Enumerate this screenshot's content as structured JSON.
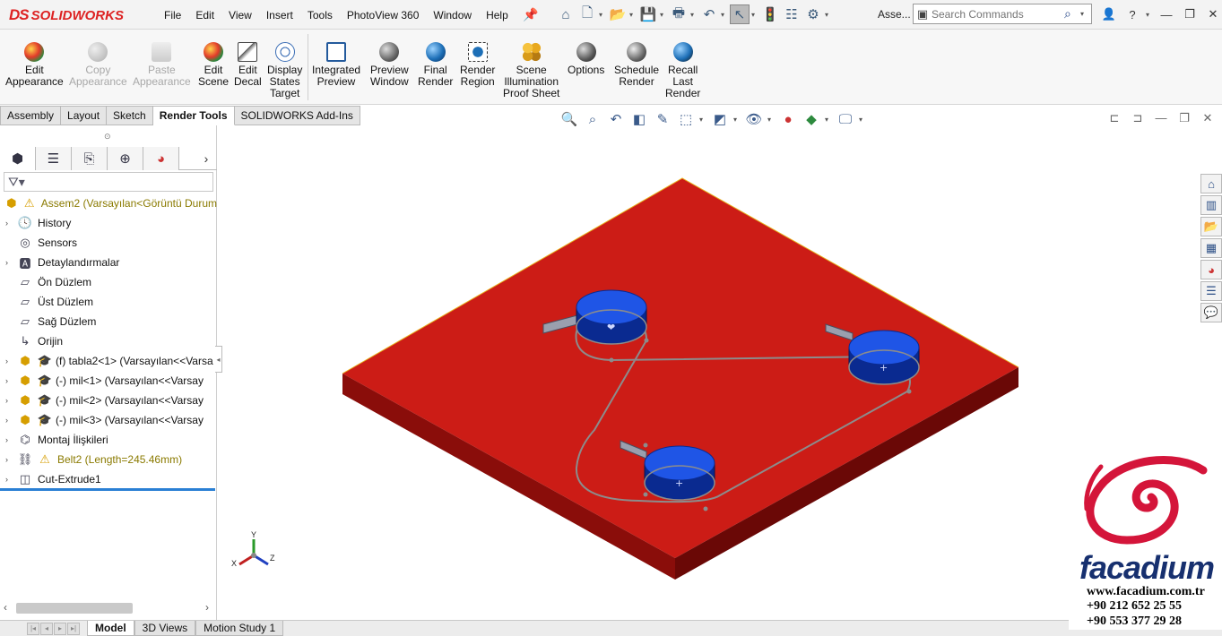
{
  "app": {
    "logo_ds": "DS",
    "logo_text": "SOLIDWORKS",
    "menu": [
      "File",
      "Edit",
      "View",
      "Insert",
      "Tools",
      "PhotoView 360",
      "Window",
      "Help"
    ],
    "doc_title": "Asse...",
    "search": {
      "placeholder": "Search Commands"
    }
  },
  "ribbon": {
    "buttons": [
      {
        "label": "Edit Appearance",
        "enabled": true
      },
      {
        "label": "Copy Appearance",
        "enabled": false
      },
      {
        "label": "Paste Appearance",
        "enabled": false
      },
      {
        "label": "Edit Scene",
        "enabled": true
      },
      {
        "label": "Edit Decal",
        "enabled": true
      },
      {
        "label": "Display States Target",
        "enabled": true
      },
      {
        "label": "Integrated Preview",
        "enabled": true
      },
      {
        "label": "Preview Window",
        "enabled": true
      },
      {
        "label": "Final Render",
        "enabled": true
      },
      {
        "label": "Render Region",
        "enabled": true
      },
      {
        "label": "Scene Illumination Proof Sheet",
        "enabled": true
      },
      {
        "label": "Options",
        "enabled": true
      },
      {
        "label": "Schedule Render",
        "enabled": true
      },
      {
        "label": "Recall Last Render",
        "enabled": true
      }
    ],
    "labels": {
      "edit_appearance": [
        "Edit",
        "Appearance"
      ],
      "copy_appearance": [
        "Copy",
        "Appearance"
      ],
      "paste_appearance": [
        "Paste",
        "Appearance"
      ],
      "edit_scene": [
        "Edit",
        "Scene"
      ],
      "edit_decal": [
        "Edit",
        "Decal"
      ],
      "display_states": [
        "Display",
        "States",
        "Target"
      ],
      "integrated_preview": [
        "Integrated",
        "Preview"
      ],
      "preview_window": [
        "Preview",
        "Window"
      ],
      "final_render": [
        "Final",
        "Render"
      ],
      "render_region": [
        "Render",
        "Region"
      ],
      "scene_illum": [
        "Scene",
        "Illumination",
        "Proof Sheet"
      ],
      "options": [
        "Options"
      ],
      "schedule_render": [
        "Schedule",
        "Render"
      ],
      "recall_render": [
        "Recall",
        "Last",
        "Render"
      ]
    }
  },
  "command_tabs": [
    "Assembly",
    "Layout",
    "Sketch",
    "Render Tools",
    "SOLIDWORKS Add-Ins"
  ],
  "active_command_tab": "Render Tools",
  "feature_tree": {
    "root": "Assem2  (Varsayılan<Görüntü Durum",
    "items": [
      {
        "label": "History",
        "icon": "history-icon",
        "expandable": true
      },
      {
        "label": "Sensors",
        "icon": "sensors-icon",
        "expandable": false
      },
      {
        "label": "Detaylandırmalar",
        "icon": "annotations-icon",
        "expandable": true
      },
      {
        "label": "Ön Düzlem",
        "icon": "plane-icon",
        "expandable": false
      },
      {
        "label": "Üst Düzlem",
        "icon": "plane-icon",
        "expandable": false
      },
      {
        "label": "Sağ Düzlem",
        "icon": "plane-icon",
        "expandable": false
      },
      {
        "label": "Orijin",
        "icon": "origin-icon",
        "expandable": false
      },
      {
        "label": "(f) tabla2<1>  (Varsayılan<<Varsa",
        "icon": "part-icon",
        "expandable": true
      },
      {
        "label": "(-) mil<1>  (Varsayılan<<Varsay",
        "icon": "part-icon",
        "expandable": true
      },
      {
        "label": "(-) mil<2>  (Varsayılan<<Varsay",
        "icon": "part-icon",
        "expandable": true
      },
      {
        "label": "(-) mil<3>  (Varsayılan<<Varsay",
        "icon": "part-icon",
        "expandable": true
      },
      {
        "label": "Montaj İlişkileri",
        "icon": "mates-icon",
        "expandable": true
      },
      {
        "label": "Belt2 (Length=245.46mm)",
        "icon": "belt-icon",
        "expandable": true,
        "warning": true
      },
      {
        "label": "Cut-Extrude1",
        "icon": "cut-extrude-icon",
        "expandable": true
      }
    ]
  },
  "bottom_tabs": [
    "Model",
    "3D Views",
    "Motion Study 1"
  ],
  "active_bottom_tab": "Model",
  "triad": {
    "x": "X",
    "y": "Y",
    "z": "Z"
  },
  "watermark": {
    "name": "facadium",
    "url": "www.facadium.com.tr",
    "phone1": "+90 212 652 25 55",
    "phone2": "+90 553 377 29 28"
  },
  "colors": {
    "plate_top": "#cc1c16",
    "plate_front": "#8a0d0a",
    "plate_side": "#6a0806",
    "pulley_top": "#1f55e6",
    "pulley_side": "#0a2a90",
    "belt": "#8c8c8c",
    "brand_red": "#d22222",
    "brand_blue": "#17306f"
  }
}
